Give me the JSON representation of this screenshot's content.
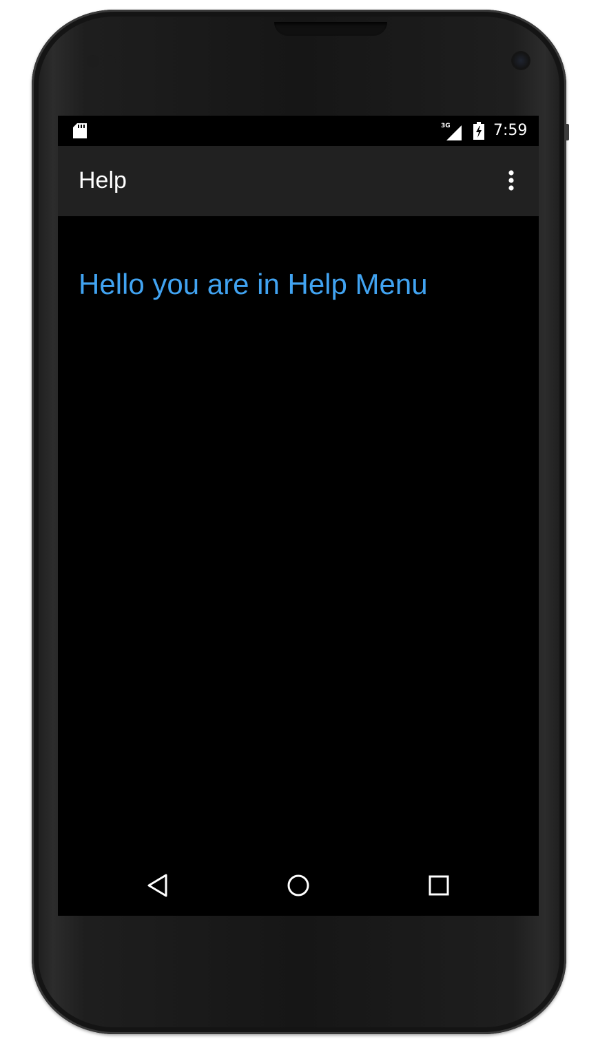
{
  "status_bar": {
    "time": "7:59",
    "network_type": "3G",
    "icons": [
      "sd-card-icon",
      "cell-signal-icon",
      "battery-charging-icon"
    ]
  },
  "action_bar": {
    "title": "Help",
    "overflow_icon": "more-vert-icon"
  },
  "content": {
    "message": "Hello you are in Help Menu"
  },
  "nav_bar": {
    "icons": [
      "back-icon",
      "home-icon",
      "recents-icon"
    ]
  },
  "colors": {
    "screen_background": "#000000",
    "action_bar_background": "#212121",
    "message_text": "#41a3f1",
    "title_text": "#ffffff"
  }
}
